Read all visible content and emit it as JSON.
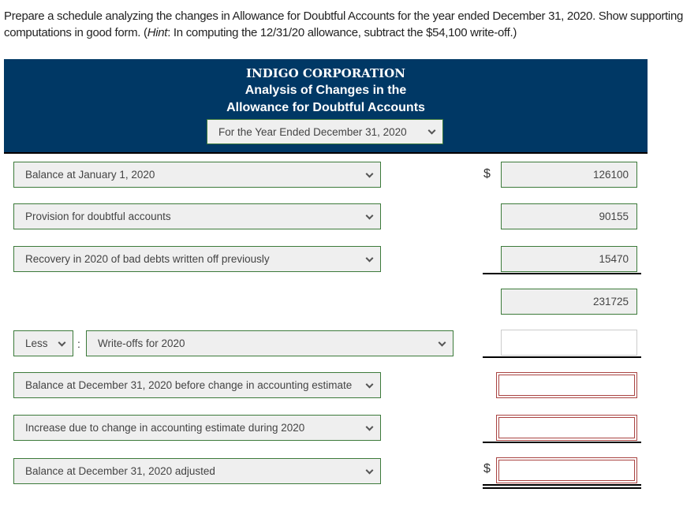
{
  "instructions": {
    "text_before_hint": "Prepare a schedule analyzing the changes in Allowance for Doubtful Accounts for the year ended December 31, 2020. Show supporting computations in good form. (",
    "hint_label": "Hint",
    "text_after_hint": ": In computing the 12/31/20 allowance, subtract the $54,100 write-off.)"
  },
  "header": {
    "company": "INDIGO CORPORATION",
    "title_line1": "Analysis of Changes in the",
    "title_line2": "Allowance for Doubtful Accounts",
    "period_select": "For the Year Ended December 31, 2020"
  },
  "rows": [
    {
      "label": "Balance at January 1, 2020",
      "amount": "126100",
      "currency": "$"
    },
    {
      "label": "Provision for doubtful accounts",
      "amount": "90155"
    },
    {
      "label": "Recovery in 2020 of bad debts written off previously",
      "amount": "15470"
    },
    {
      "label": "",
      "amount": "231725"
    },
    {
      "operator": "Less",
      "separator": ":",
      "label": "Write-offs for 2020",
      "amount": ""
    },
    {
      "label": "Balance at December 31, 2020 before change in accounting estimate",
      "amount": ""
    },
    {
      "label": "Increase due to change in accounting estimate during 2020",
      "amount": ""
    },
    {
      "label": "Balance at December 31, 2020 adjusted",
      "amount": "",
      "currency": "$"
    }
  ],
  "colors": {
    "header_bg": "#003865",
    "field_border": "#3c7a3a",
    "error_border": "#a94442"
  }
}
